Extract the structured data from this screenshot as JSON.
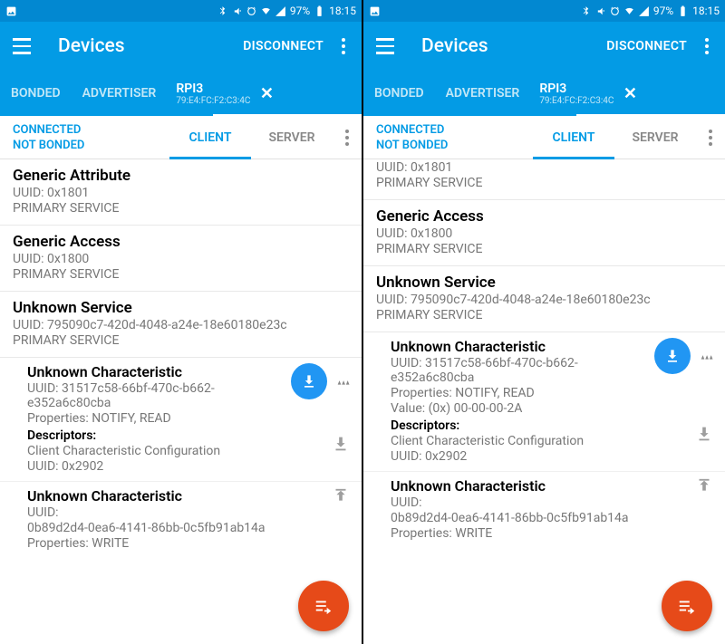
{
  "status": {
    "battery": "97%",
    "time": "18:15"
  },
  "header": {
    "title": "Devices",
    "disconnect": "DISCONNECT"
  },
  "tabs": {
    "bonded": "BONDED",
    "advertiser": "ADVERTISER",
    "devName": "RPI3",
    "devMac": "79:E4:FC:F2:C3:4C"
  },
  "conn": {
    "state1": "CONNECTED",
    "state2": "NOT BONDED",
    "client": "CLIENT",
    "server": "SERVER"
  },
  "labels": {
    "uuid": "UUID:",
    "primary": "PRIMARY SERVICE",
    "props": "Properties:",
    "desc": "Descriptors:",
    "val": "Value:"
  },
  "svc": {
    "ga": {
      "name": "Generic Attribute",
      "uuid": "UUID: 0x1801"
    },
    "gac": {
      "name": "Generic Access",
      "uuid": "UUID: 0x1800"
    },
    "unk": {
      "name": "Unknown Service",
      "uuid": "UUID: 795090c7-420d-4048-a24e-18e60180e23c"
    }
  },
  "ch1": {
    "name": "Unknown Characteristic",
    "uuid": "UUID: 31517c58-66bf-470c-b662-e352a6c80cba",
    "props": "Properties: NOTIFY, READ",
    "value": "Value: (0x) 00-00-00-2A",
    "ccc": "Client Characteristic Configuration",
    "cccu": "UUID: 0x2902"
  },
  "ch2": {
    "name": "Unknown Characteristic",
    "uuid1": "UUID:",
    "uuid2": "0b89d2d4-0ea6-4141-86bb-0c5fb91ab14a",
    "props": "Properties: WRITE"
  }
}
